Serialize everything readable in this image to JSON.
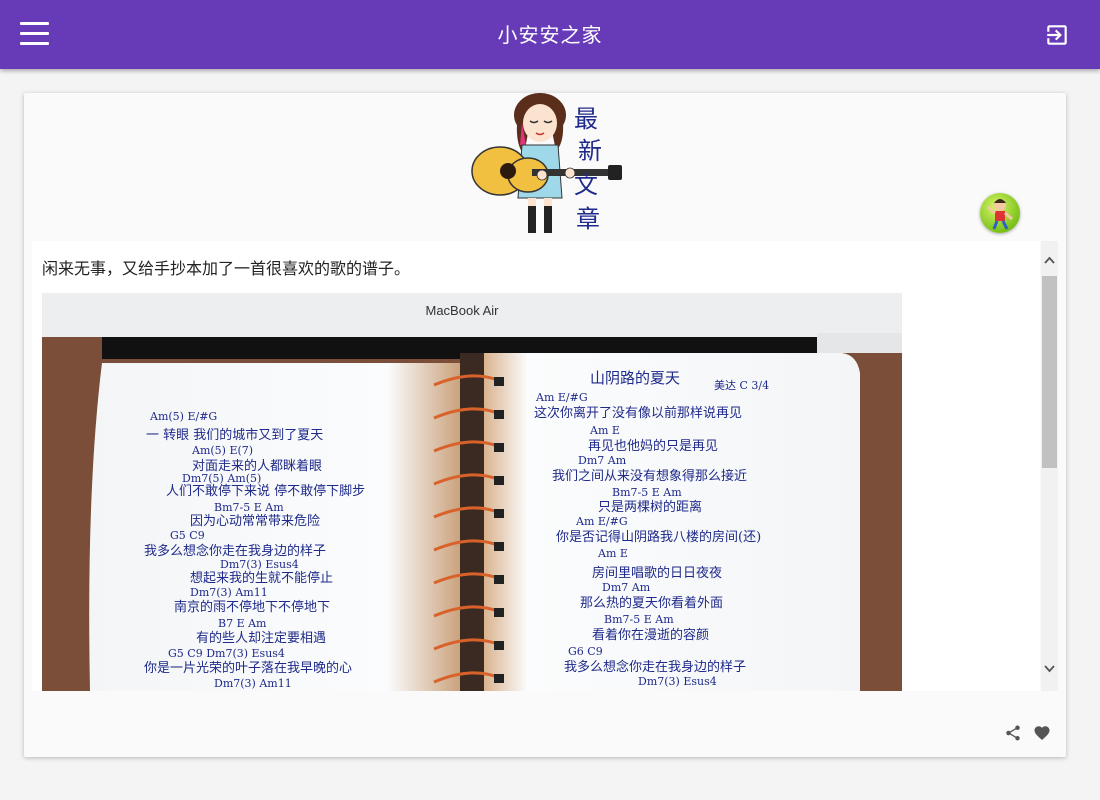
{
  "header": {
    "title": "小安安之家",
    "menu_icon": "menu-icon",
    "login_icon": "login-icon"
  },
  "banner": {
    "text_chars": [
      "最",
      "新",
      "文",
      "章"
    ]
  },
  "post": {
    "text": "闲来无事，又给手抄本加了一首很喜欢的歌的谱子。",
    "photo": {
      "laptop_label": "MacBook Air",
      "right_page_title": "山阴路的夏天",
      "right_page_meta": "美达    C    3/4",
      "left_lines": [
        "一 转眼 我们的城市又到了夏天",
        "对面走来的人都眯着眼",
        "人们不敢停下来说 停不敢停下脚步",
        "因为心动常常带来危险",
        "我多么想念你走在我身边的样子",
        "想起来我的生就不能停止",
        "南京的雨不停地下不停地下",
        "有的些人却注定要相遇",
        "你是一片光荣的叶子落在我早晚的心"
      ],
      "left_chords": [
        "Am(5)  E/#G",
        "Am(5)  E(7)",
        "Dm7(5)  Am(5)",
        "Bm7-5  E  Am",
        "G5  C9",
        "Dm7(3)  Esus4",
        "Dm7(3)  Am11",
        "B7  E  Am",
        "G5  C9  Dm7(3)  Esus4",
        "Dm7(3)  Am11"
      ],
      "right_lines": [
        "这次你离开了没有像以前那样说再见",
        "再见也他妈的只是再见",
        "我们之间从来没有想象得那么接近",
        "只是两棵树的距离",
        "你是否记得山阴路我八楼的房间(还)",
        "房间里唱歌的日日夜夜",
        "那么热的夏天你看着外面",
        "看着你在漫逝的容颜",
        "我多么想念你走在我身边的样子"
      ],
      "right_chords": [
        "Am  E/#G",
        "Am  E",
        "Dm7  Am",
        "Bm7-5  E  Am",
        "Am  E/#G",
        "Am  E",
        "Dm7  Am",
        "Bm7-5  E  Am",
        "G6  C9",
        "Dm7(3)  Esus4"
      ]
    }
  },
  "actions": {
    "share_icon": "share-icon",
    "like_icon": "heart-icon"
  },
  "colors": {
    "app_bar": "#673ab7",
    "page_bg": "#f4f4f4",
    "card_bg": "#fafafa",
    "ink": "#1f2a8a"
  }
}
